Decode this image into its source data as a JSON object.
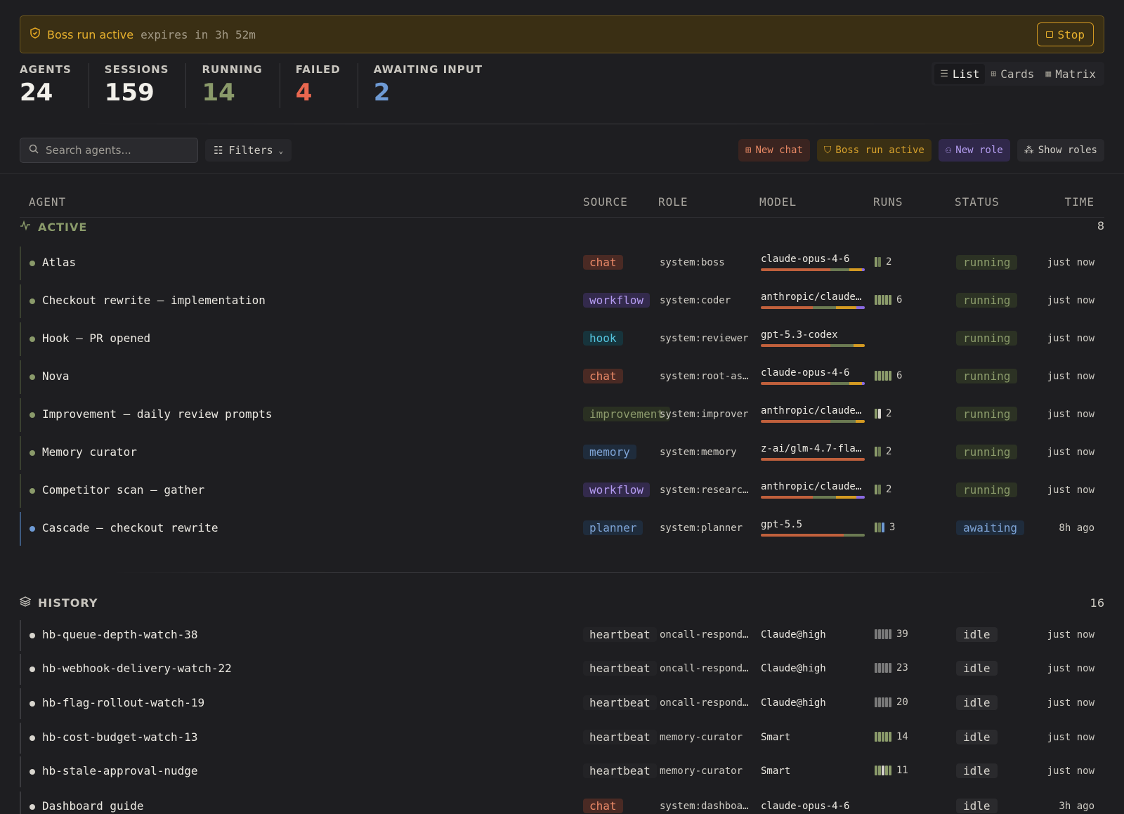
{
  "banner": {
    "title": "Boss run active",
    "subtitle": "expires in 3h 52m",
    "stop_label": "Stop"
  },
  "stats": [
    {
      "label": "AGENTS",
      "value": "24",
      "color": "#f2f0ea"
    },
    {
      "label": "SESSIONS",
      "value": "159",
      "color": "#f2f0ea"
    },
    {
      "label": "RUNNING",
      "value": "14",
      "color": "#8a9a6a"
    },
    {
      "label": "FAILED",
      "value": "4",
      "color": "#e8674f"
    },
    {
      "label": "AWAITING INPUT",
      "value": "2",
      "color": "#6e9ad4"
    }
  ],
  "views": {
    "list": "List",
    "cards": "Cards",
    "matrix": "Matrix",
    "active": "list"
  },
  "toolbar": {
    "search_placeholder": "Search agents...",
    "filters_label": "Filters",
    "new_chat": "New chat",
    "boss_run": "Boss run active",
    "new_role": "New role",
    "show_roles": "Show roles"
  },
  "columns": {
    "agent": "AGENT",
    "source": "SOURCE",
    "role": "ROLE",
    "model": "MODEL",
    "runs": "RUNS",
    "status": "STATUS",
    "time": "TIME"
  },
  "active": {
    "label": "ACTIVE",
    "count": "8",
    "rows": [
      {
        "name": "Atlas",
        "source": "chat",
        "role": "system:boss",
        "model": "claude-opus-4-6",
        "bar": [
          [
            "#c0603c",
            0.67
          ],
          [
            "#6b7a52",
            0.18
          ],
          [
            "#d49a22",
            0.12
          ],
          [
            "#8a6ae0",
            0.03
          ]
        ],
        "runs": "2",
        "ticks": [
          "#8a9a6a",
          "#6b7a52"
        ],
        "status": "running",
        "time": "just now"
      },
      {
        "name": "Checkout rewrite — implementation",
        "source": "workflow",
        "role": "system:coder",
        "model": "anthropic/claude…",
        "bar": [
          [
            "#c0603c",
            0.5
          ],
          [
            "#6b7a52",
            0.22
          ],
          [
            "#d49a22",
            0.2
          ],
          [
            "#8a6ae0",
            0.08
          ]
        ],
        "runs": "6",
        "ticks": [
          "#8a9a6a",
          "#8a9a6a",
          "#8a9a6a",
          "#8a9a6a",
          "#8a9a6a"
        ],
        "status": "running",
        "time": "just now"
      },
      {
        "name": "Hook — PR opened",
        "source": "hook",
        "role": "system:reviewer",
        "model": "gpt-5.3-codex",
        "bar": [
          [
            "#c0603c",
            0.67
          ],
          [
            "#6b7a52",
            0.22
          ],
          [
            "#d49a22",
            0.11
          ]
        ],
        "runs": "",
        "ticks": [],
        "status": "running",
        "time": "just now"
      },
      {
        "name": "Nova",
        "source": "chat",
        "role": "system:root-as…",
        "model": "claude-opus-4-6",
        "bar": [
          [
            "#c0603c",
            0.67
          ],
          [
            "#6b7a52",
            0.18
          ],
          [
            "#d49a22",
            0.12
          ],
          [
            "#8a6ae0",
            0.03
          ]
        ],
        "runs": "6",
        "ticks": [
          "#8a9a6a",
          "#8a9a6a",
          "#8a9a6a",
          "#8a9a6a",
          "#8a9a6a"
        ],
        "status": "running",
        "time": "just now"
      },
      {
        "name": "Improvement — daily review prompts",
        "source": "improvement",
        "role": "system:improver",
        "model": "anthropic/claude…",
        "bar": [
          [
            "#c0603c",
            0.67
          ],
          [
            "#6b7a52",
            0.24
          ],
          [
            "#d49a22",
            0.09
          ]
        ],
        "runs": "2",
        "ticks": [
          "#8a9a6a",
          "#d8d5ce"
        ],
        "status": "running",
        "time": "just now"
      },
      {
        "name": "Memory curator",
        "source": "memory",
        "role": "system:memory",
        "model": "z-ai/glm-4.7-fla…",
        "bar": [
          [
            "#c0603c",
            1.0
          ]
        ],
        "runs": "2",
        "ticks": [
          "#8a9a6a",
          "#6b7a52"
        ],
        "status": "running",
        "time": "just now"
      },
      {
        "name": "Competitor scan — gather",
        "source": "workflow",
        "role": "system:researc…",
        "model": "anthropic/claude…",
        "bar": [
          [
            "#c0603c",
            0.5
          ],
          [
            "#6b7a52",
            0.22
          ],
          [
            "#d49a22",
            0.2
          ],
          [
            "#8a6ae0",
            0.08
          ]
        ],
        "runs": "2",
        "ticks": [
          "#8a9a6a",
          "#6b7a52"
        ],
        "status": "running",
        "time": "just now"
      },
      {
        "name": "Cascade — checkout rewrite",
        "source": "planner",
        "role": "system:planner",
        "model": "gpt-5.5",
        "bar": [
          [
            "#c0603c",
            0.8
          ],
          [
            "#6b7a52",
            0.2
          ]
        ],
        "runs": "3",
        "ticks": [
          "#8a9a6a",
          "#6b7a52",
          "#6e9ad4"
        ],
        "status": "awaiting",
        "time": "8h ago"
      }
    ]
  },
  "history": {
    "label": "HISTORY",
    "count": "16",
    "rows": [
      {
        "name": "hb-queue-depth-watch-38",
        "source": "heartbeat",
        "role": "oncall-respond…",
        "model": "Claude@high",
        "bar": [],
        "runs": "39",
        "ticks": [
          "#7a7a7a",
          "#7a7a7a",
          "#7a7a7a",
          "#7a7a7a",
          "#7a7a7a"
        ],
        "status": "idle",
        "time": "just now"
      },
      {
        "name": "hb-webhook-delivery-watch-22",
        "source": "heartbeat",
        "role": "oncall-respond…",
        "model": "Claude@high",
        "bar": [],
        "runs": "23",
        "ticks": [
          "#7a7a7a",
          "#7a7a7a",
          "#7a7a7a",
          "#7a7a7a",
          "#7a7a7a"
        ],
        "status": "idle",
        "time": "just now"
      },
      {
        "name": "hb-flag-rollout-watch-19",
        "source": "heartbeat",
        "role": "oncall-respond…",
        "model": "Claude@high",
        "bar": [],
        "runs": "20",
        "ticks": [
          "#7a7a7a",
          "#7a7a7a",
          "#7a7a7a",
          "#7a7a7a",
          "#7a7a7a"
        ],
        "status": "idle",
        "time": "just now"
      },
      {
        "name": "hb-cost-budget-watch-13",
        "source": "heartbeat",
        "role": "memory-curator",
        "model": "Smart",
        "bar": [],
        "runs": "14",
        "ticks": [
          "#8a9a6a",
          "#8a9a6a",
          "#8a9a6a",
          "#8a9a6a",
          "#8a9a6a"
        ],
        "status": "idle",
        "time": "just now"
      },
      {
        "name": "hb-stale-approval-nudge",
        "source": "heartbeat",
        "role": "memory-curator",
        "model": "Smart",
        "bar": [],
        "runs": "11",
        "ticks": [
          "#8a9a6a",
          "#8a9a6a",
          "#d8d5ce",
          "#8a9a6a",
          "#8a9a6a"
        ],
        "status": "idle",
        "time": "just now"
      },
      {
        "name": "Dashboard guide",
        "source": "chat",
        "role": "system:dashboa…",
        "model": "claude-opus-4-6",
        "bar": [],
        "runs": "",
        "ticks": [],
        "status": "idle",
        "time": "3h ago"
      }
    ]
  },
  "colors": {
    "running_dot": "#8a9a6a",
    "awaiting_dot": "#6e9ad4",
    "idle_dot": "#d8d5ce"
  }
}
